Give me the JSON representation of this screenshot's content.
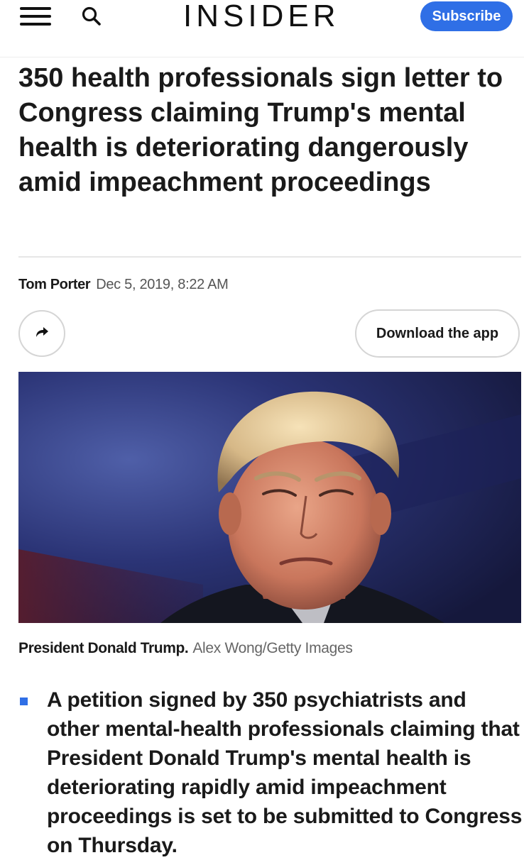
{
  "header": {
    "logo_text": "INSIDER",
    "subscribe_label": "Subscribe",
    "menu_icon": "hamburger-menu-icon",
    "search_icon": "search-icon",
    "accent_color": "#2f6fe6"
  },
  "article": {
    "headline": "350 health professionals sign letter to Congress claiming Trump's mental health is deteriorating dangerously amid impeachment proceedings",
    "author": "Tom Porter",
    "date": "Dec 5, 2019, 8:22 AM",
    "share_icon": "share-arrow-icon",
    "download_app_label": "Download the app",
    "image_caption": "President Donald Trump.",
    "image_credit": "Alex Wong/Getty Images",
    "bullets": [
      "A petition signed by 350 psychiatrists and other mental-health professionals claiming that President Donald Trump's mental health is deteriorating rapidly amid impeachment proceedings is set to be submitted to Congress on Thursday."
    ]
  }
}
